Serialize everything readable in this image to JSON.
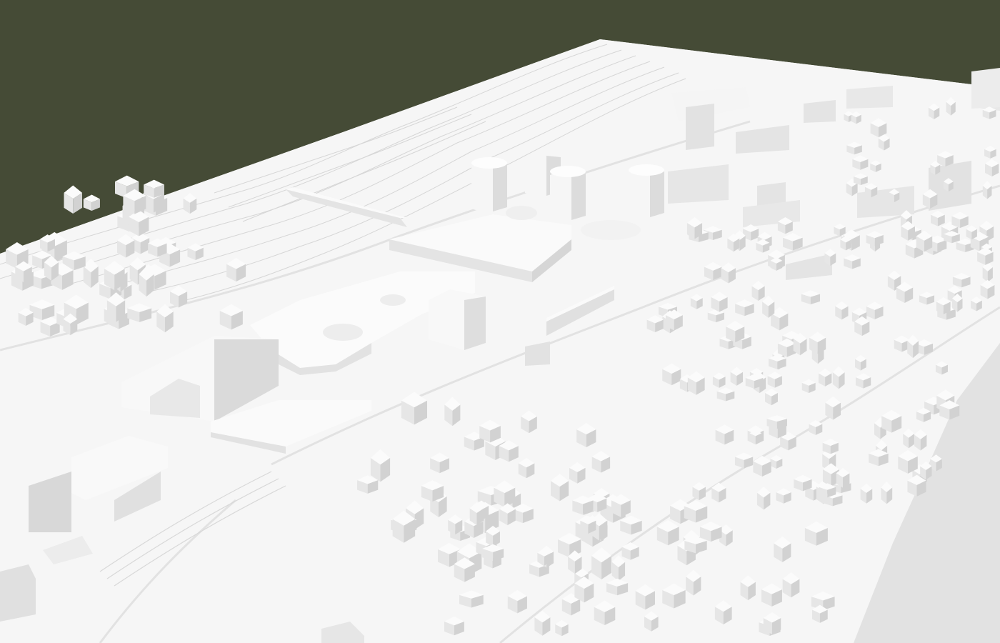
{
  "scene": {
    "subject": "white-architectural-site-model",
    "colors": {
      "background": "#454b36",
      "model_base": "#f4f4f4",
      "model_edge": "#dcdcdc",
      "building_top": "#fbfbfb",
      "building_side": "#e6e6e6",
      "building_dark_side": "#d2d2d2",
      "contour": "#d0d0d0",
      "road": "#ececec"
    }
  }
}
